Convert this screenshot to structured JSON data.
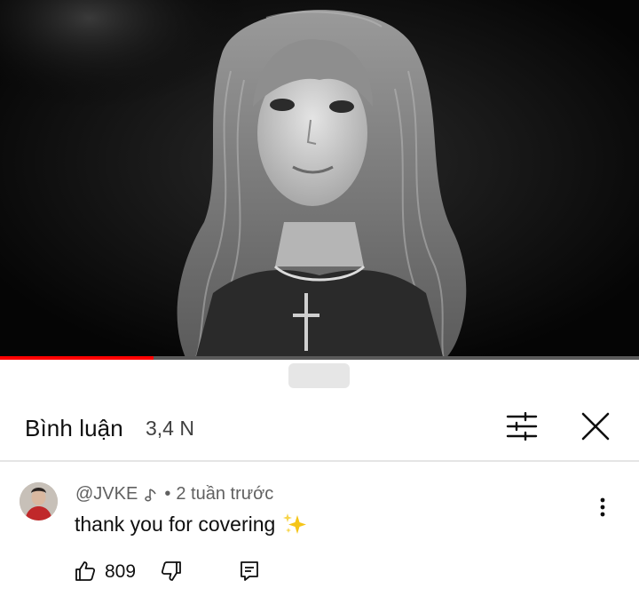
{
  "video": {
    "progress_fraction": 0.24
  },
  "comments_panel": {
    "title": "Bình luận",
    "count": "3,4 N",
    "icons": {
      "filter": "filter-sliders-icon",
      "close": "close-icon"
    }
  },
  "comment": {
    "author": "@JVKE",
    "author_badge_icon": "music-note-icon",
    "separator": "•",
    "time": "2 tuần trước",
    "text": "thank you for covering",
    "emoji_icon": "sparkles-icon",
    "likes": "809",
    "action_icons": [
      "thumbs-up-icon",
      "thumbs-down-icon",
      "reply-icon",
      "more-vertical-icon"
    ]
  },
  "colors": {
    "progress": "#ff0000",
    "text_primary": "#0f0f0f",
    "text_secondary": "#606060",
    "sparkles": "#f5c518"
  }
}
